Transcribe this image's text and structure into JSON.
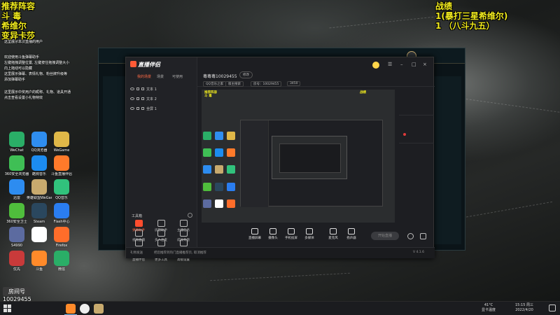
{
  "overlay": {
    "left_lines": [
      "推荐阵容",
      "斗 毒",
      "希维尔",
      "变异卡莎"
    ],
    "right_title": "战绩",
    "right_lines": [
      "1(暴打三星希维尔)",
      "1 （八斗九五）"
    ],
    "notice": [
      "这里展示本次直播的用户",
      "欢迎使用斗鱼弹幕助手",
      "左键拖拽调整位置, 左键按住拖拽调整大小",
      "向上拖动可以隐藏",
      "这里展示弹幕、表情礼物、粉丝牌升级等",
      "添加弹幕助手",
      "这里展示中奖用户的昵称、礼物、道具开通",
      "点击查看设置小礼物特效"
    ],
    "room_id_label": "房间号",
    "room_id": "10029455"
  },
  "desktop_icons": [
    {
      "label": "WeChat",
      "color": "#2aae67"
    },
    {
      "label": "QQ浏览器",
      "color": "#2f8ef0"
    },
    {
      "label": "WeGame",
      "color": "#e0b848"
    },
    {
      "label": "360安全浏览器",
      "color": "#3fbf55"
    },
    {
      "label": "酷狗音乐",
      "color": "#1c8cf0"
    },
    {
      "label": "斗鱼直播伴侣",
      "color": "#ff7a2a"
    },
    {
      "label": "迅雷",
      "color": "#2d8cf0"
    },
    {
      "label": "英雄联盟WeGame版",
      "color": "#c8aa6e"
    },
    {
      "label": "QQ音乐",
      "color": "#31c27c"
    },
    {
      "label": "360安全卫士",
      "color": "#4fbd3c"
    },
    {
      "label": "Steam",
      "color": "#2a475e"
    },
    {
      "label": "Flash中心",
      "color": "#2a7df0"
    },
    {
      "label": "S4990",
      "color": "#5c6ba0"
    },
    {
      "label": "",
      "color": "#ffffff"
    },
    {
      "label": "Firefox",
      "color": "#ff6d2a"
    },
    {
      "label": "优先",
      "color": "#c93a3a"
    },
    {
      "label": "斗鱼",
      "color": "#ff8a2a"
    },
    {
      "label": "微信",
      "color": "#2aae67"
    }
  ],
  "app": {
    "logo": "直播伴侣",
    "tabs": [
      "我的场景",
      "场景",
      "可使用"
    ],
    "sources": [
      {
        "label": "文本 1"
      },
      {
        "label": "文本 2"
      },
      {
        "label": "全屏 1"
      }
    ],
    "tools_head": "工具箱",
    "tools": [
      "弹幕助手",
      "房管助手",
      "主播任务",
      "视频直播",
      "多人连麦",
      "成就专题",
      "虚拟形象",
      "弹幕服",
      "歌词提示",
      "直播伴侣",
      "更多工具",
      "高级设置"
    ],
    "room_title": "毒毒毒10029455",
    "room_button": "修改",
    "chips": [
      "QQ音乐之家",
      "版主搜索",
      "房号：10029455",
      "3450"
    ],
    "controls": [
      "直播屏幕",
      "摄像头",
      "手机投屏",
      "多媒体",
      "麦克风",
      "扬声器"
    ],
    "live_button": "开始直播",
    "status_left": "礼物发送",
    "status_mid": "把您推荐到热门直播推荐页, 取消推荐",
    "status_right": "V 4.1.6"
  },
  "taskbar": {
    "temp": "41°C",
    "temp_sub": "显卡温度",
    "time": "15:15",
    "weekday": "周三",
    "date": "2022/4/20"
  }
}
